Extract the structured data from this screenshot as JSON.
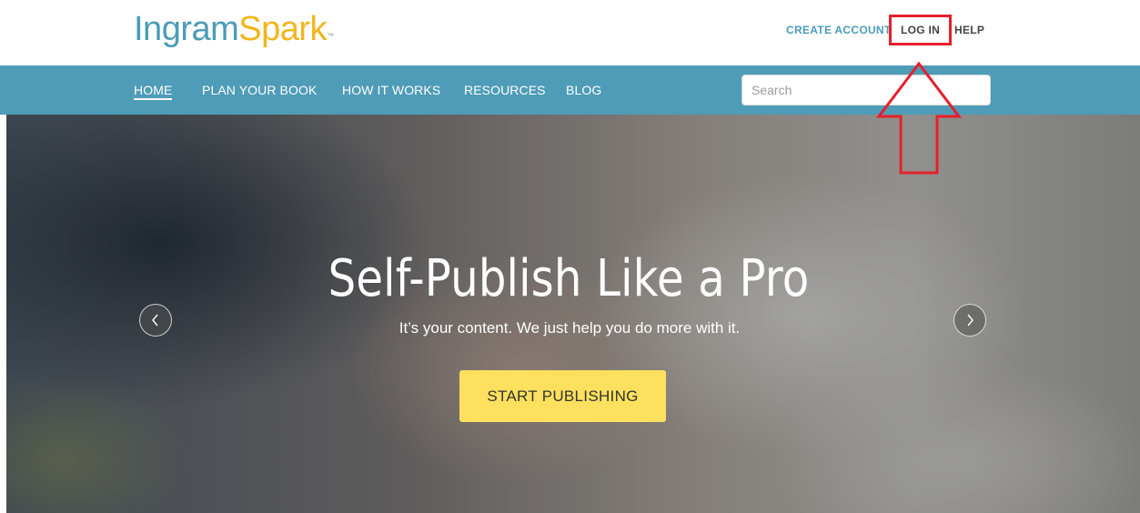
{
  "header": {
    "logo": {
      "part1": "Ingram",
      "part2": "Spark",
      "trademark": "™"
    },
    "links": {
      "create_account": "CREATE ACCOUNT",
      "log_in": "LOG IN",
      "help": "HELP"
    }
  },
  "nav": {
    "items": [
      {
        "label": "HOME",
        "active": true
      },
      {
        "label": "PLAN YOUR BOOK",
        "active": false
      },
      {
        "label": "HOW IT WORKS",
        "active": false
      },
      {
        "label": "RESOURCES",
        "active": false
      },
      {
        "label": "BLOG",
        "active": false
      }
    ],
    "search": {
      "placeholder": "Search",
      "value": ""
    }
  },
  "hero": {
    "title": "Self-Publish Like a Pro",
    "subtitle": "It’s your content. We just help you do more with it.",
    "cta_label": "START PUBLISHING",
    "prev_icon": "chevron-left-icon",
    "next_icon": "chevron-right-icon"
  },
  "annotation": {
    "highlight_color": "#e5202b",
    "arrow_icon": "up-arrow-icon"
  },
  "colors": {
    "brand_blue": "#4b9cb6",
    "brand_yellow": "#f2b51c",
    "nav_bg": "#4e9cb7",
    "cta_bg": "#fde05d"
  }
}
